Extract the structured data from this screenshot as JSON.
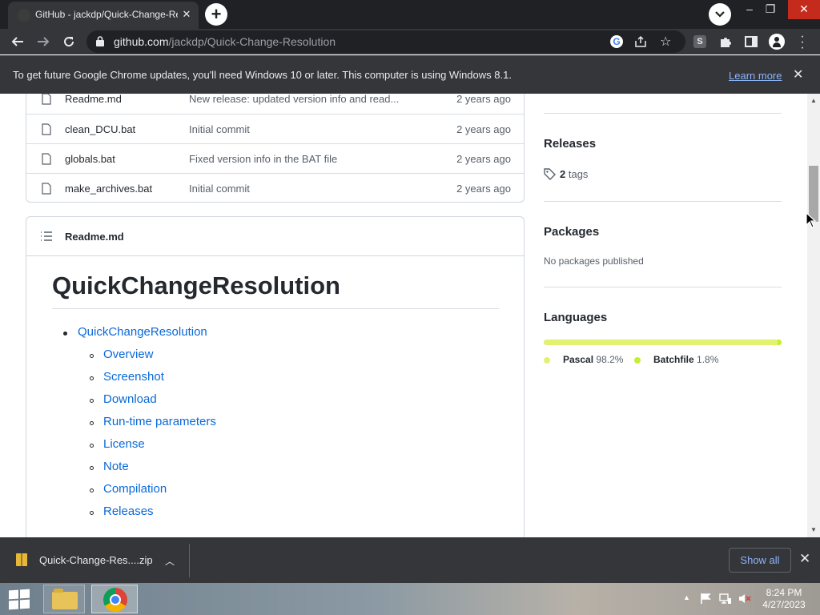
{
  "browser": {
    "tab_title": "GitHub - jackdp/Quick-Change-Resolution",
    "url_host": "github.com",
    "url_path": "/jackdp/Quick-Change-Resolution",
    "info_message": "To get future Google Chrome updates, you'll need Windows 10 or later. This computer is using Windows 8.1.",
    "info_link": "Learn more"
  },
  "files": [
    {
      "name": "Readme.md",
      "message": "New release: updated version info and read...",
      "age": "2 years ago"
    },
    {
      "name": "clean_DCU.bat",
      "message": "Initial commit",
      "age": "2 years ago"
    },
    {
      "name": "globals.bat",
      "message": "Fixed version info in the BAT file",
      "age": "2 years ago"
    },
    {
      "name": "make_archives.bat",
      "message": "Initial commit",
      "age": "2 years ago"
    }
  ],
  "readme": {
    "file_label": "Readme.md",
    "title": "QuickChangeResolution",
    "toc_top": "QuickChangeResolution",
    "toc": [
      "Overview",
      "Screenshot",
      "Download",
      "Run-time parameters",
      "License",
      "Note",
      "Compilation",
      "Releases"
    ]
  },
  "sidebar": {
    "releases_heading": "Releases",
    "tags_count": "2",
    "tags_label": "tags",
    "packages_heading": "Packages",
    "packages_text": "No packages published",
    "languages_heading": "Languages",
    "languages": [
      {
        "name": "Pascal",
        "percent": "98.2%",
        "value": 98.2,
        "color": "#e3f171"
      },
      {
        "name": "Batchfile",
        "percent": "1.8%",
        "value": 1.8,
        "color": "#c1f12e"
      }
    ]
  },
  "downloads": {
    "file_name": "Quick-Change-Res....zip",
    "show_all": "Show all"
  },
  "taskbar": {
    "time": "8:24 PM",
    "date": "4/27/2023"
  },
  "scroll": {
    "position": 0.45
  }
}
